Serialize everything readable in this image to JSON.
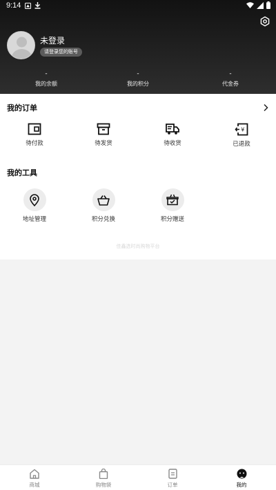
{
  "status_bar": {
    "time": "9:14"
  },
  "profile": {
    "title": "未登录",
    "login_prompt": "请登录您的账号"
  },
  "stats": [
    {
      "value": "-",
      "label": "我的余额"
    },
    {
      "value": "-",
      "label": "我的积分"
    },
    {
      "value": "-",
      "label": "代金券"
    }
  ],
  "orders": {
    "title": "我的订单",
    "items": [
      {
        "label": "待付款",
        "icon": "wallet-icon"
      },
      {
        "label": "待发货",
        "icon": "box-icon"
      },
      {
        "label": "待收货",
        "icon": "truck-icon"
      },
      {
        "label": "已退款",
        "icon": "refund-icon"
      }
    ]
  },
  "tools": {
    "title": "我的工具",
    "items": [
      {
        "label": "地址管理",
        "icon": "location-pin-icon"
      },
      {
        "label": "积分兑换",
        "icon": "basket-icon"
      },
      {
        "label": "积分赠送",
        "icon": "gift-basket-icon"
      }
    ]
  },
  "footer_note": "佳鑫选时尚购物平台",
  "bottom_nav": [
    {
      "label": "商城",
      "icon": "home-icon",
      "active": false
    },
    {
      "label": "购物袋",
      "icon": "bag-icon",
      "active": false
    },
    {
      "label": "订单",
      "icon": "order-icon",
      "active": false
    },
    {
      "label": "我的",
      "icon": "profile-icon",
      "active": true
    }
  ],
  "colors": {
    "header_dark": "#121212",
    "accent": "#111111",
    "muted": "#888888"
  }
}
